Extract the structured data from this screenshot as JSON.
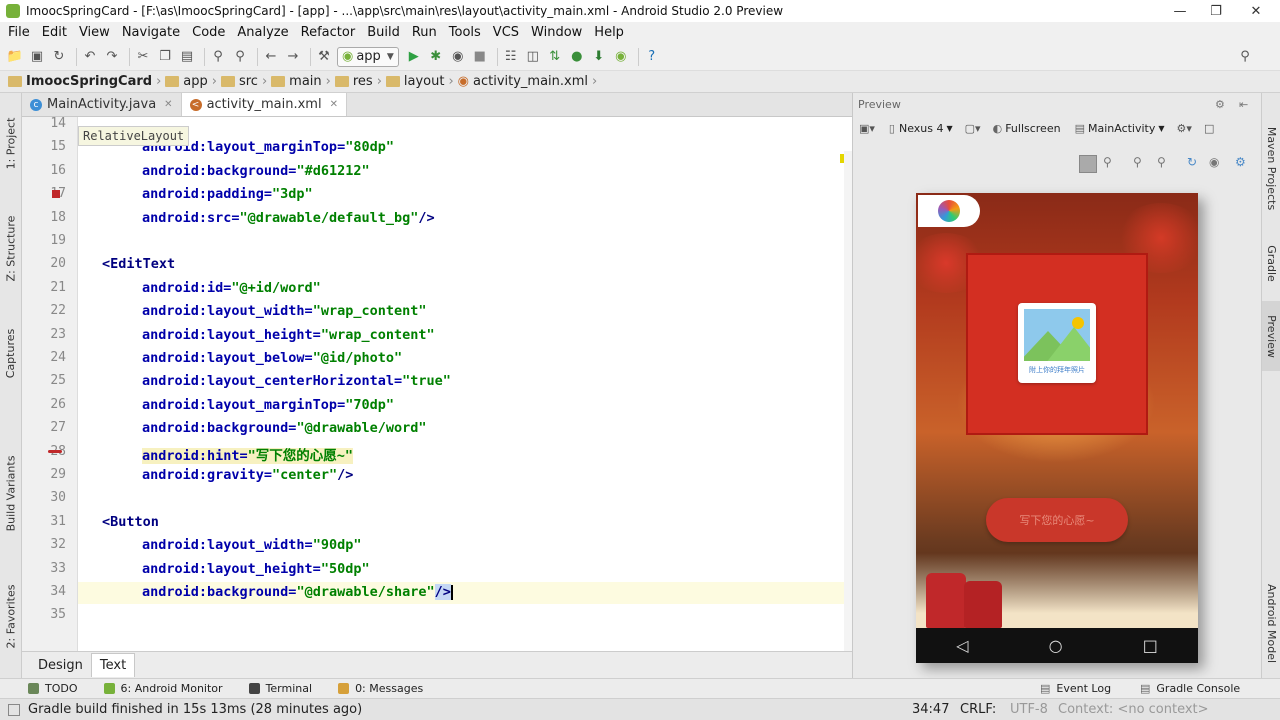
{
  "window": {
    "title": "ImoocSpringCard - [F:\\as\\ImoocSpringCard] - [app] - ...\\app\\src\\main\\res\\layout\\activity_main.xml - Android Studio 2.0 Preview"
  },
  "menu": [
    "File",
    "Edit",
    "View",
    "Navigate",
    "Code",
    "Analyze",
    "Refactor",
    "Build",
    "Run",
    "Tools",
    "VCS",
    "Window",
    "Help"
  ],
  "toolbar": {
    "run_config": "app"
  },
  "breadcrumbs": [
    "ImoocSpringCard",
    "app",
    "src",
    "main",
    "res",
    "layout",
    "activity_main.xml"
  ],
  "left_tool_tabs": [
    "1: Project",
    "Z: Structure",
    "Captures",
    "Build Variants",
    "2: Favorites"
  ],
  "right_tool_tabs": [
    "Maven Projects",
    "Gradle",
    "Preview",
    "Android Model"
  ],
  "editor_tabs": [
    {
      "label": "MainActivity.java",
      "active": false
    },
    {
      "label": "activity_main.xml",
      "active": true
    }
  ],
  "breadcrumb_tooltip": "RelativeLayout",
  "code_lines": [
    {
      "n": "14",
      "segments": [
        {
          "t": "        android:layout_centerHorizontal=\"true\"",
          "c": "attr"
        }
      ]
    },
    {
      "n": "15",
      "segments": [
        {
          "t": "android:layout_marginTop=",
          "c": "attr2"
        },
        {
          "t": "\"80dp\"",
          "c": "val"
        }
      ]
    },
    {
      "n": "16",
      "segments": [
        {
          "t": "android:background=",
          "c": "attr2"
        },
        {
          "t": "\"#d61212\"",
          "c": "val"
        }
      ]
    },
    {
      "n": "17",
      "segments": [
        {
          "t": "android:padding=",
          "c": "attr2"
        },
        {
          "t": "\"3dp\"",
          "c": "val"
        }
      ]
    },
    {
      "n": "18",
      "segments": [
        {
          "t": "android:src=",
          "c": "attr2"
        },
        {
          "t": "\"@drawable/default_bg\"",
          "c": "val"
        },
        {
          "t": "/>",
          "c": "tag"
        }
      ]
    },
    {
      "n": "19",
      "segments": []
    },
    {
      "n": "20",
      "segments": [
        {
          "t": "<EditText",
          "c": "tag"
        }
      ]
    },
    {
      "n": "21",
      "segments": [
        {
          "t": "android:id=",
          "c": "attr2"
        },
        {
          "t": "\"@+id/word\"",
          "c": "val"
        }
      ]
    },
    {
      "n": "22",
      "segments": [
        {
          "t": "android:layout_width=",
          "c": "attr2"
        },
        {
          "t": "\"wrap_content\"",
          "c": "val"
        }
      ]
    },
    {
      "n": "23",
      "segments": [
        {
          "t": "android:layout_height=",
          "c": "attr2"
        },
        {
          "t": "\"wrap_content\"",
          "c": "val"
        }
      ]
    },
    {
      "n": "24",
      "segments": [
        {
          "t": "android:layout_below=",
          "c": "attr2"
        },
        {
          "t": "\"@id/photo\"",
          "c": "val"
        }
      ]
    },
    {
      "n": "25",
      "segments": [
        {
          "t": "android:layout_centerHorizontal=",
          "c": "attr2"
        },
        {
          "t": "\"true\"",
          "c": "val"
        }
      ]
    },
    {
      "n": "26",
      "segments": [
        {
          "t": "android:layout_marginTop=",
          "c": "attr2"
        },
        {
          "t": "\"70dp\"",
          "c": "val"
        }
      ]
    },
    {
      "n": "27",
      "segments": [
        {
          "t": "android:background=",
          "c": "attr2"
        },
        {
          "t": "\"@drawable/word\"",
          "c": "val"
        }
      ]
    },
    {
      "n": "28",
      "segments": [
        {
          "t": "android:hint=",
          "c": "attr2"
        },
        {
          "t": "\"写下您的心愿~\"",
          "c": "val"
        }
      ]
    },
    {
      "n": "29",
      "segments": [
        {
          "t": "android:gravity=",
          "c": "attr2"
        },
        {
          "t": "\"center\"",
          "c": "val"
        },
        {
          "t": "/>",
          "c": "tag"
        }
      ]
    },
    {
      "n": "30",
      "segments": []
    },
    {
      "n": "31",
      "segments": [
        {
          "t": "<Button",
          "c": "tag"
        }
      ]
    },
    {
      "n": "32",
      "segments": [
        {
          "t": "android:layout_width=",
          "c": "attr2"
        },
        {
          "t": "\"90dp\"",
          "c": "val"
        }
      ]
    },
    {
      "n": "33",
      "segments": [
        {
          "t": "android:layout_height=",
          "c": "attr2"
        },
        {
          "t": "\"50dp\"",
          "c": "val"
        }
      ]
    },
    {
      "n": "34",
      "segments": [
        {
          "t": "android:background=",
          "c": "attr2"
        },
        {
          "t": "\"@drawable/share\"",
          "c": "val"
        },
        {
          "t": "/>",
          "c": "tag"
        }
      ]
    },
    {
      "n": "35",
      "segments": []
    }
  ],
  "design_tabs": [
    {
      "label": "Design",
      "active": false
    },
    {
      "label": "Text",
      "active": true
    }
  ],
  "preview": {
    "title": "Preview",
    "device": "Nexus 4",
    "fullscreen_label": "Fullscreen",
    "activity": "MainActivity",
    "photo_caption": "附上你的拜年照片",
    "hint_text": "写下您的心愿~"
  },
  "tool_windows": [
    {
      "label": "TODO",
      "color": "#6a8759"
    },
    {
      "label": "6: Android Monitor",
      "color": "#77b13a"
    },
    {
      "label": "Terminal",
      "color": "#444444"
    },
    {
      "label": "0: Messages",
      "color": "#d6a03a"
    }
  ],
  "tool_windows_right": [
    "Event Log",
    "Gradle Console"
  ],
  "status": {
    "message": "Gradle build finished in 15s 13ms (28 minutes ago)",
    "position": "34:47",
    "line_sep": "CRLF:",
    "encoding": "UTF-8",
    "context": "Context: <no context>"
  },
  "colors": {
    "accent_red": "#d61212",
    "highlight_line": "#fdfbe0",
    "hint_highlight": "#f7f1c0"
  }
}
